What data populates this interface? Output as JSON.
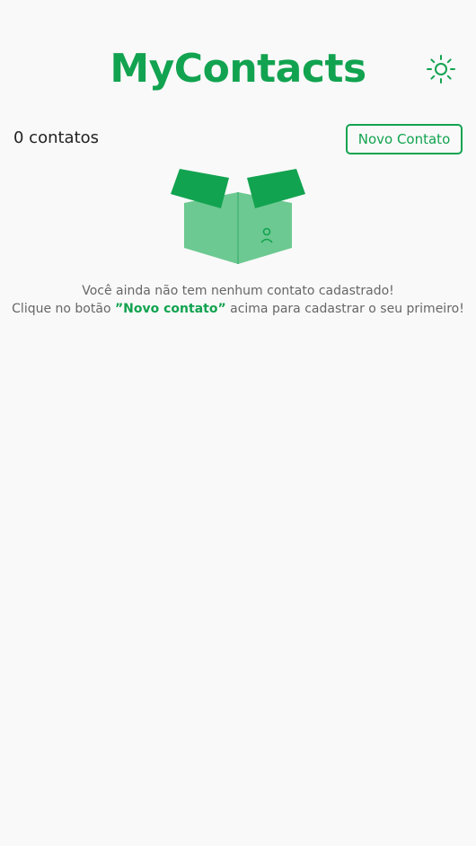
{
  "app": {
    "title": "MyContacts"
  },
  "header": {
    "theme_toggle_icon": "sun-icon"
  },
  "toolbar": {
    "contacts_count": "0 contatos",
    "new_contact_label": "Novo Contato"
  },
  "empty_state": {
    "icon": "empty-box-icon",
    "line1": "Você ainda não tem nenhum contato cadastrado!",
    "line2_prefix": "Clique no botão ",
    "line2_highlight": "”Novo contato”",
    "line2_suffix": " acima para cadastrar o seu primeiro!"
  },
  "colors": {
    "primary": "#12a350",
    "primary_light": "#6cc991",
    "background": "#f9f9f9",
    "text": "#222222",
    "muted_text": "#666666"
  }
}
